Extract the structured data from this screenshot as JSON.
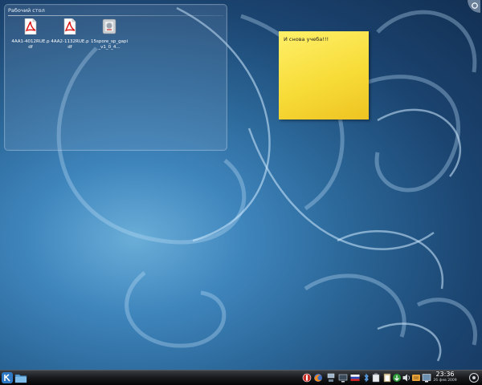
{
  "desktop": {
    "folder_view_title": "Рабочий стол",
    "files": [
      {
        "name": "4AA1-4012RUE.pdf",
        "icon": "pdf-icon"
      },
      {
        "name": "4AA2-1132RUE.pdf",
        "icon": "pdf-icon"
      },
      {
        "name": "15spore_sp_gapi_v1_0_4...",
        "icon": "archive-icon"
      }
    ],
    "sticky_note": "И снова учеба!!!"
  },
  "taskbar": {
    "launcher_icon": "kde-menu-icon",
    "folder_icon": "folder-icon",
    "tray_icons": [
      "antivirus-icon",
      "firefox-icon",
      "network-icon",
      "monitor-icon",
      "keyboard-layout-icon",
      "bluetooth-icon",
      "battery-icon",
      "clipboard-icon",
      "update-icon",
      "volume-icon",
      "download-icon",
      "display-icon"
    ],
    "clock_time": "23:36",
    "clock_date": "26 фев 2009"
  },
  "colors": {
    "note_yellow": "#f7dc38",
    "desktop_blue": "#2a6596"
  }
}
